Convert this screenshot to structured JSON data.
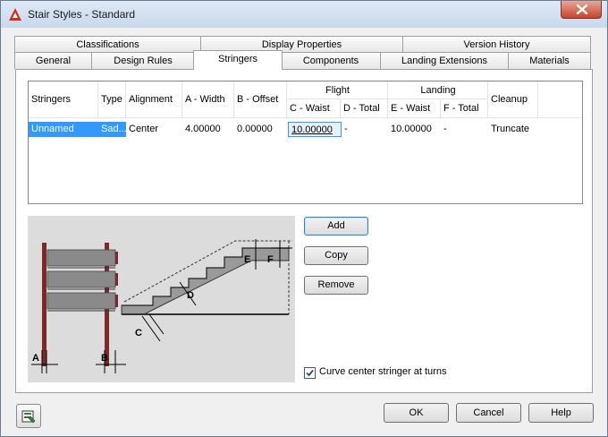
{
  "window": {
    "title": "Stair Styles - Standard",
    "icon": "autocad-a-icon",
    "close_icon": "close-x-icon"
  },
  "tabs": {
    "back_row": [
      {
        "label": "Classifications"
      },
      {
        "label": "Display Properties"
      },
      {
        "label": "Version History"
      }
    ],
    "front_row": [
      {
        "label": "General"
      },
      {
        "label": "Design Rules"
      },
      {
        "label": "Stringers",
        "active": true
      },
      {
        "label": "Components"
      },
      {
        "label": "Landing Extensions"
      },
      {
        "label": "Materials"
      }
    ]
  },
  "grid": {
    "headers": {
      "stringers": "Stringers",
      "type": "Type",
      "alignment": "Alignment",
      "a_width": "A - Width",
      "b_offset": "B - Offset",
      "flight": "Flight",
      "c_waist": "C - Waist",
      "d_total": "D - Total",
      "landing": "Landing",
      "e_waist": "E - Waist",
      "f_total": "F - Total",
      "cleanup": "Cleanup"
    },
    "rows": [
      {
        "stringers": "Unnamed",
        "type": "Sad...",
        "alignment": "Center",
        "a_width": "4.00000",
        "b_offset": "0.00000",
        "c_waist": "10.00000",
        "d_total": "-",
        "e_waist": "10.00000",
        "f_total": "-",
        "cleanup": "Truncate"
      }
    ]
  },
  "figure": {
    "labels": [
      "A",
      "B",
      "C",
      "D",
      "E",
      "F"
    ]
  },
  "buttons": {
    "add": "Add",
    "copy": "Copy",
    "remove": "Remove"
  },
  "options": {
    "curve_center_stringer": {
      "label": "Curve center stringer at turns",
      "checked": true
    }
  },
  "footer": {
    "ok": "OK",
    "cancel": "Cancel",
    "help": "Help",
    "help_icon": "style-manager-icon"
  },
  "colors": {
    "selection": "#3399ff",
    "close_button": "#c7432c",
    "titlebar": "#dfe9f5"
  }
}
